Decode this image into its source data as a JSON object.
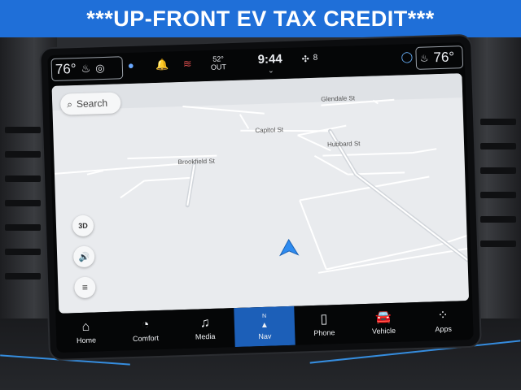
{
  "banner": {
    "text": "***UP-FRONT EV TAX CREDIT***"
  },
  "status_bar": {
    "left_temp": "76°",
    "right_temp": "76°",
    "outside_temp": "52°",
    "outside_label": "OUT",
    "clock": "9:44",
    "fan_level": "8"
  },
  "map": {
    "search_placeholder": "Search",
    "view_mode": "3D",
    "streets": [
      "Glendale St",
      "Capitol St",
      "Hubbard St",
      "Brookfield St"
    ]
  },
  "nav": {
    "items": [
      {
        "label": "Home",
        "icon": "home-icon"
      },
      {
        "label": "Comfort",
        "icon": "comfort-icon"
      },
      {
        "label": "Media",
        "icon": "music-note-icon"
      },
      {
        "label": "Nav",
        "icon": "compass-icon",
        "active": true
      },
      {
        "label": "Phone",
        "icon": "phone-icon"
      },
      {
        "label": "Vehicle",
        "icon": "car-icon"
      },
      {
        "label": "Apps",
        "icon": "grid-icon"
      }
    ],
    "compass_heading": "N"
  },
  "colors": {
    "banner": "#1f6fd8",
    "active_tab": "#1c5fb8",
    "location_arrow": "#2e8bf0",
    "accent_trim": "#3aa0ff"
  }
}
